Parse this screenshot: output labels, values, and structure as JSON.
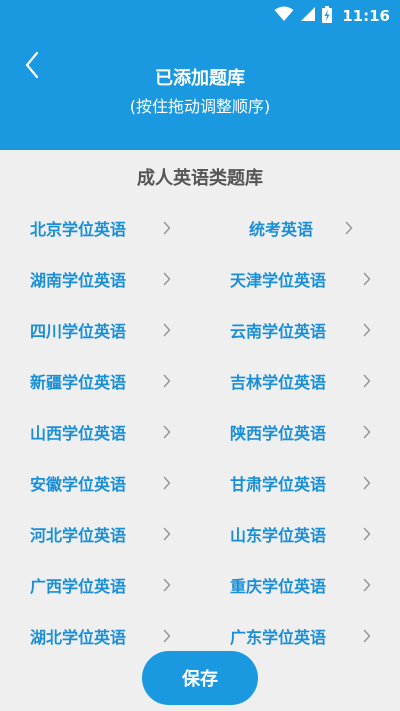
{
  "status_bar": {
    "time": "11:16"
  },
  "header": {
    "title": "已添加题库",
    "subtitle": "(按住拖动调整顺序)"
  },
  "section": {
    "title": "成人英语类题库"
  },
  "items": [
    "北京学位英语",
    "统考英语",
    "湖南学位英语",
    "天津学位英语",
    "四川学位英语",
    "云南学位英语",
    "新疆学位英语",
    "吉林学位英语",
    "山西学位英语",
    "陕西学位英语",
    "安徽学位英语",
    "甘肃学位英语",
    "河北学位英语",
    "山东学位英语",
    "广西学位英语",
    "重庆学位英语",
    "湖北学位英语",
    "广东学位英语"
  ],
  "save_button": {
    "label": "保存"
  },
  "colors": {
    "accent": "#1a98e0",
    "link": "#1a8fd8",
    "background": "#efefef"
  },
  "icons": [
    "wifi-icon",
    "signal-icon",
    "battery-icon",
    "back-arrow-icon",
    "chevron-right-icon"
  ]
}
